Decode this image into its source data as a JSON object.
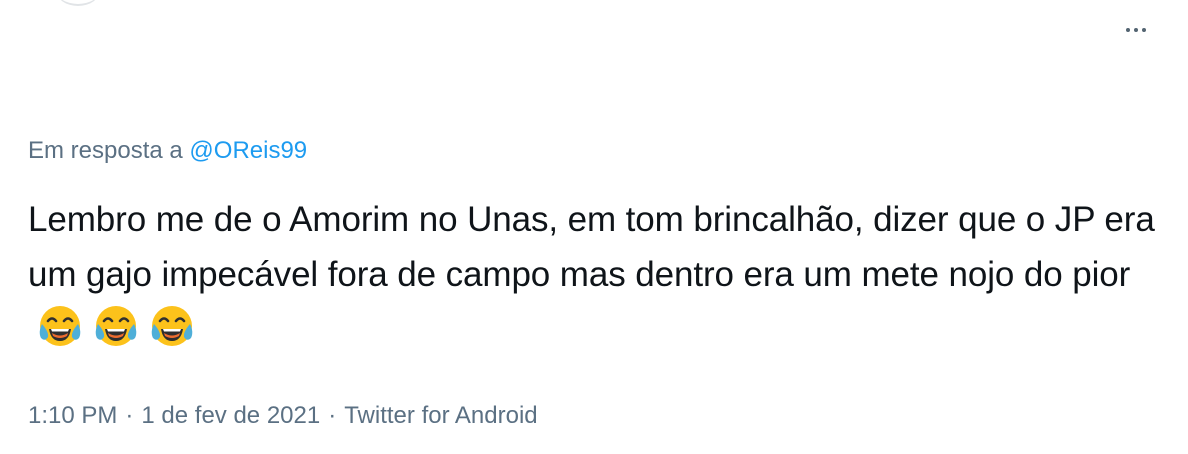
{
  "reply": {
    "prefix": "Em resposta a",
    "handle": "@OReis99"
  },
  "tweet": {
    "text": "Lembro me de o Amorim no Unas, em tom brincalhão, dizer que o JP era um gajo impecável fora de campo mas dentro era um mete nojo do pior",
    "emojis": [
      "face-with-tears-of-joy-icon",
      "face-with-tears-of-joy-icon",
      "face-with-tears-of-joy-icon"
    ]
  },
  "meta": {
    "time": "1:10 PM",
    "separator": "·",
    "date": "1 de fev de 2021",
    "source": "Twitter for Android"
  },
  "colors": {
    "text": "#0f1419",
    "secondary": "#5b7083",
    "link": "#1d9bf0",
    "emoji_face": "#fcc21b"
  }
}
